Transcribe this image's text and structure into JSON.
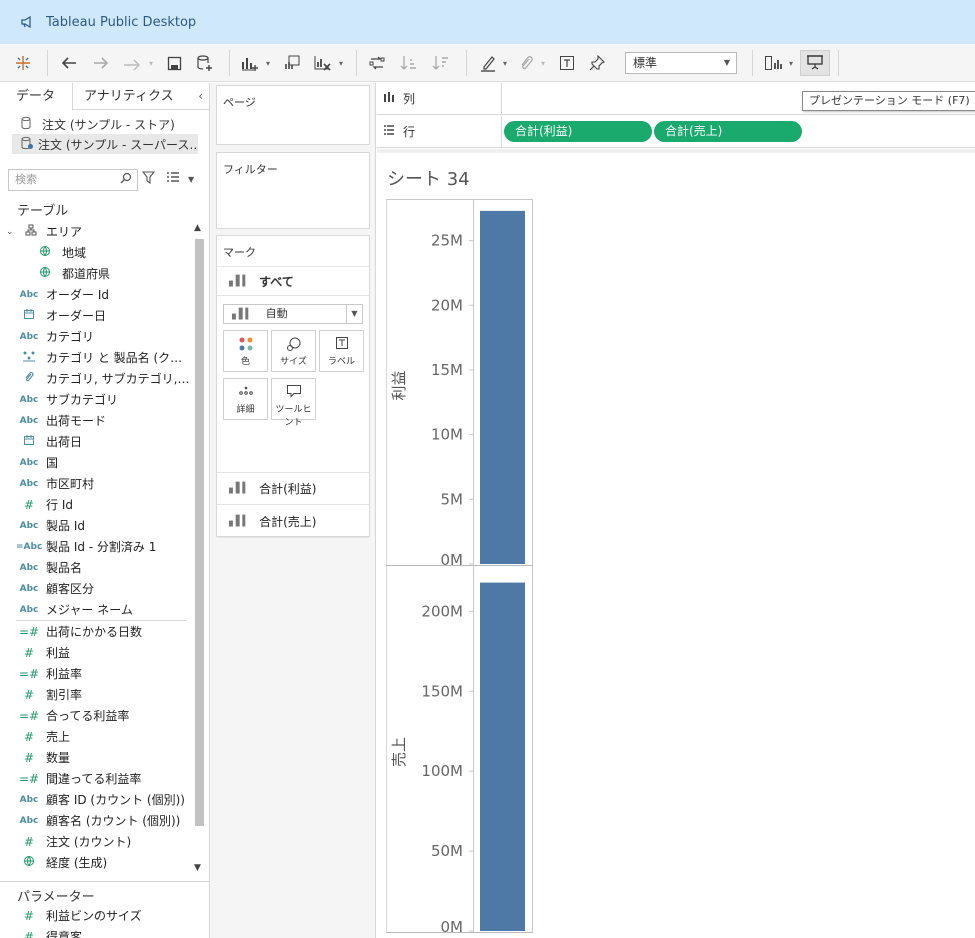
{
  "window": {
    "title": "Tableau Public Desktop"
  },
  "toolbar": {
    "zoom_value": "標準",
    "tooltip": "プレゼンテーション モード (F7)"
  },
  "data_pane": {
    "tabs": {
      "data": "データ",
      "analytics": "アナリティクス"
    },
    "datasources": [
      {
        "label": "注文 (サンプル - ストア)",
        "selected": false
      },
      {
        "label": "注文 (サンプル - スーパース…",
        "selected": true
      }
    ],
    "search_placeholder": "検索",
    "section_tables": "テーブル",
    "fields": [
      {
        "label": "エリア",
        "type": "folder",
        "icon": "hierarchy-icon"
      },
      {
        "label": "地域",
        "type": "geo",
        "sub": true,
        "icon": "globe-icon"
      },
      {
        "label": "都道府県",
        "type": "geo",
        "sub": true,
        "icon": "globe-icon"
      },
      {
        "label": "オーダー Id",
        "type": "dimension",
        "icon": "abc-icon"
      },
      {
        "label": "オーダー日",
        "type": "date",
        "icon": "calendar-icon"
      },
      {
        "label": "カテゴリ",
        "type": "dimension",
        "icon": "abc-icon"
      },
      {
        "label": "カテゴリ と 製品名 (クラス…",
        "type": "dimension",
        "icon": "cluster-icon"
      },
      {
        "label": "カテゴリ, サブカテゴリ, 顧…",
        "type": "dimension",
        "icon": "paperclip-icon"
      },
      {
        "label": "サブカテゴリ",
        "type": "dimension",
        "icon": "abc-icon"
      },
      {
        "label": "出荷モード",
        "type": "dimension",
        "icon": "abc-icon"
      },
      {
        "label": "出荷日",
        "type": "date",
        "icon": "calendar-icon"
      },
      {
        "label": "国",
        "type": "dimension",
        "icon": "abc-icon"
      },
      {
        "label": "市区町村",
        "type": "dimension",
        "icon": "abc-icon"
      },
      {
        "label": "行 Id",
        "type": "measure",
        "icon": "hash-icon"
      },
      {
        "label": "製品 Id",
        "type": "dimension",
        "icon": "abc-icon"
      },
      {
        "label": "製品 Id - 分割済み 1",
        "type": "dimension",
        "icon": "calc-abc-icon"
      },
      {
        "label": "製品名",
        "type": "dimension",
        "icon": "abc-icon"
      },
      {
        "label": "顧客区分",
        "type": "dimension",
        "icon": "abc-icon"
      },
      {
        "label": "メジャー ネーム",
        "type": "dimension",
        "icon": "abc-icon",
        "divider_after": true
      },
      {
        "label": "出荷にかかる日数",
        "type": "measure",
        "icon": "calc-hash-icon"
      },
      {
        "label": "利益",
        "type": "measure",
        "icon": "hash-icon"
      },
      {
        "label": "利益率",
        "type": "measure",
        "icon": "calc-hash-icon"
      },
      {
        "label": "割引率",
        "type": "measure",
        "icon": "hash-icon"
      },
      {
        "label": "合ってる利益率",
        "type": "measure",
        "icon": "calc-hash-icon"
      },
      {
        "label": "売上",
        "type": "measure",
        "icon": "hash-icon"
      },
      {
        "label": "数量",
        "type": "measure",
        "icon": "hash-icon"
      },
      {
        "label": "間違ってる利益率",
        "type": "measure",
        "icon": "calc-hash-icon"
      },
      {
        "label": "顧客 ID (カウント (個別))",
        "type": "dimension",
        "icon": "abc-icon"
      },
      {
        "label": "顧客名 (カウント (個別))",
        "type": "dimension",
        "icon": "abc-icon"
      },
      {
        "label": "注文 (カウント)",
        "type": "measure",
        "icon": "hash-icon"
      },
      {
        "label": "経度 (生成)",
        "type": "geo",
        "icon": "globe-icon"
      }
    ],
    "section_params": "パラメーター",
    "params": [
      {
        "label": "利益ビンのサイズ",
        "icon": "hash-icon"
      },
      {
        "label": "得意客",
        "icon": "hash-icon"
      }
    ]
  },
  "shelves": {
    "pages": "ページ",
    "filters": "フィルター",
    "marks": "マーク",
    "marks_all": "すべて",
    "mark_type": "自動",
    "mark_buttons": [
      {
        "label": "色",
        "icon": "color-dots-icon"
      },
      {
        "label": "サイズ",
        "icon": "size-icon"
      },
      {
        "label": "ラベル",
        "icon": "label-icon"
      },
      {
        "label": "詳細",
        "icon": "detail-icon"
      },
      {
        "label": "ツールヒント",
        "icon": "tooltip-icon"
      }
    ],
    "marks_pills": [
      "合計(利益)",
      "合計(売上)"
    ]
  },
  "view": {
    "columns_label": "列",
    "rows_label": "行",
    "row_pills": [
      "合計(利益)",
      "合計(売上)"
    ],
    "sheet_title": "シート 34",
    "bar_color": "#4e79a7",
    "pill_color": "#1aaa6e"
  },
  "chart_data": [
    {
      "type": "bar",
      "ylabel": "利益",
      "ticks": [
        "0M",
        "5M",
        "10M",
        "15M",
        "20M",
        "25M"
      ],
      "tick_values": [
        0,
        5,
        10,
        15,
        20,
        25
      ],
      "ylim": [
        0,
        27.6
      ],
      "values": [
        27.3
      ],
      "unit": "M"
    },
    {
      "type": "bar",
      "ylabel": "売上",
      "ticks": [
        "0M",
        "50M",
        "100M",
        "150M",
        "200M"
      ],
      "tick_values": [
        0,
        50,
        100,
        150,
        200
      ],
      "ylim": [
        0,
        224
      ],
      "values": [
        218
      ],
      "unit": "M"
    }
  ]
}
